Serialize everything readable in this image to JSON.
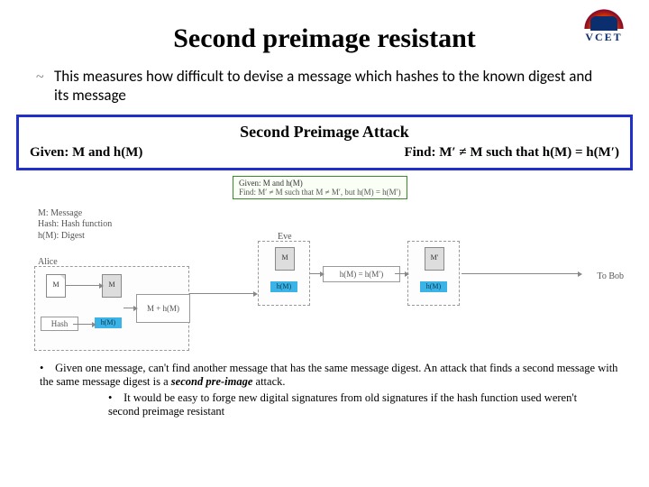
{
  "logo": {
    "text": "VCET"
  },
  "title": "Second preimage resistant",
  "intro": {
    "bullet": "~",
    "text": "This measures how difficult to devise a message which hashes to the known digest and its message"
  },
  "bluebox": {
    "heading": "Second Preimage Attack",
    "given": "Given: M and h(M)",
    "find": "Find: M′ ≠ M such that h(M) = h(M′)"
  },
  "diagram": {
    "green_line1": "Given: M and h(M)",
    "green_line2": "Find: M′ ≠ M such that M ≠ M′, but h(M) = h(M′)",
    "defs_m": "M: Message",
    "defs_hash": "Hash: Hash function",
    "defs_hm": "h(M): Digest",
    "alice": "Alice",
    "eve": "Eve",
    "tobob": "To Bob",
    "box_hash": "Hash",
    "doc_M": "M",
    "doc_Mp": "M′",
    "blue_hm": "h(M)",
    "blue_mhm": "M + h(M)",
    "eq_hm": "h(M) = h(M′)"
  },
  "bottom": {
    "line1_pre": "Given one message, can't find another message that has the same message digest.   An attack that finds a second message with the same message digest is a ",
    "line1_em": "second pre-image",
    "line1_post": " attack.",
    "sub": "It would be easy to forge new digital signatures from old signatures if the hash function used weren't second preimage resistant"
  }
}
